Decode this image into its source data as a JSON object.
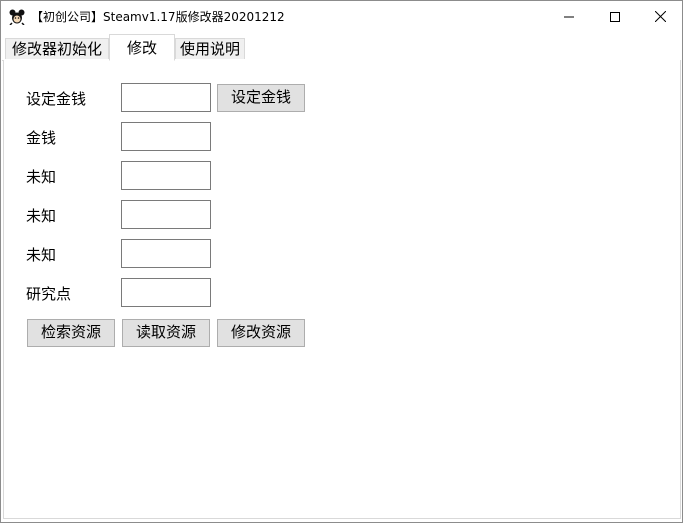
{
  "window": {
    "title": "【初创公司】Steamv1.17版修改器20201212",
    "icon": "mascot-icon",
    "controls": {
      "minimize": "minimize-icon",
      "maximize": "maximize-icon",
      "close": "close-icon"
    }
  },
  "tabs": [
    {
      "label": "修改器初始化",
      "active": false
    },
    {
      "label": "修改",
      "active": true
    },
    {
      "label": "使用说明",
      "active": false
    }
  ],
  "form": {
    "rows": [
      {
        "label": "设定金钱",
        "value": ""
      },
      {
        "label": "金钱",
        "value": ""
      },
      {
        "label": "未知",
        "value": ""
      },
      {
        "label": "未知",
        "value": ""
      },
      {
        "label": "未知",
        "value": ""
      },
      {
        "label": "研究点",
        "value": ""
      }
    ],
    "set_money_button": "设定金钱"
  },
  "actions": {
    "search": "检索资源",
    "read": "读取资源",
    "modify": "修改资源"
  }
}
